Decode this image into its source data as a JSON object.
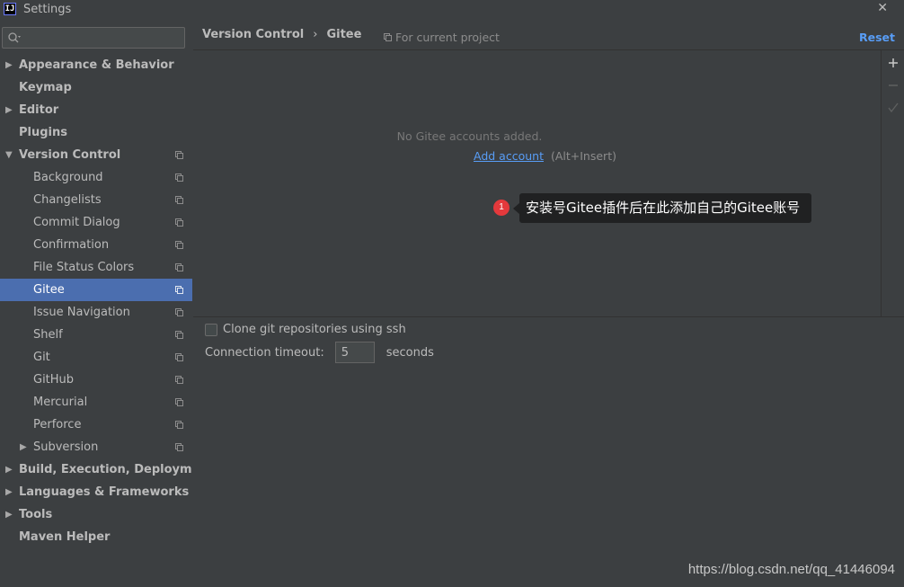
{
  "window": {
    "logo_text": "IJ",
    "title": "Settings",
    "close_glyph": "✕"
  },
  "search": {
    "placeholder": "",
    "value": "",
    "icon": "search-icon"
  },
  "sidebar": {
    "items": [
      {
        "label": "Appearance & Behavior",
        "arrow": "▶"
      },
      {
        "label": "Keymap",
        "arrow": ""
      },
      {
        "label": "Editor",
        "arrow": "▶"
      },
      {
        "label": "Plugins",
        "arrow": ""
      },
      {
        "label": "Version Control",
        "arrow": "▼"
      },
      {
        "label": "Background"
      },
      {
        "label": "Changelists"
      },
      {
        "label": "Commit Dialog"
      },
      {
        "label": "Confirmation"
      },
      {
        "label": "File Status Colors"
      },
      {
        "label": "Gitee",
        "selected": true
      },
      {
        "label": "Issue Navigation"
      },
      {
        "label": "Shelf"
      },
      {
        "label": "Git"
      },
      {
        "label": "GitHub"
      },
      {
        "label": "Mercurial"
      },
      {
        "label": "Perforce"
      },
      {
        "label": "Subversion",
        "arrow": "▶"
      },
      {
        "label": "Build, Execution, Deployment",
        "arrow": "▶"
      },
      {
        "label": "Languages & Frameworks",
        "arrow": "▶"
      },
      {
        "label": "Tools",
        "arrow": "▶"
      },
      {
        "label": "Maven Helper",
        "arrow": ""
      }
    ]
  },
  "breadcrumb": {
    "parent": "Version Control",
    "separator": "›",
    "current": "Gitee"
  },
  "scope_note": "For current project",
  "reset_label": "Reset",
  "accounts": {
    "empty_text": "No Gitee accounts added.",
    "add_link": "Add account",
    "add_shortcut": "(Alt+Insert)",
    "toolbar": {
      "add": "+",
      "remove": "−",
      "default": "✓"
    }
  },
  "annotation": {
    "badge": "1",
    "text": "安装号Gitee插件后在此添加自己的Gitee账号"
  },
  "options": {
    "clone_ssh_label": "Clone git repositories using ssh",
    "clone_ssh_checked": false,
    "timeout_label": "Connection timeout:",
    "timeout_value": "5",
    "timeout_unit": "seconds"
  },
  "watermark": "https://blog.csdn.net/qq_41446094",
  "colors": {
    "background": "#3c3f41",
    "selection": "#4b6eaf",
    "link": "#589df6",
    "badge": "#e4393c"
  }
}
